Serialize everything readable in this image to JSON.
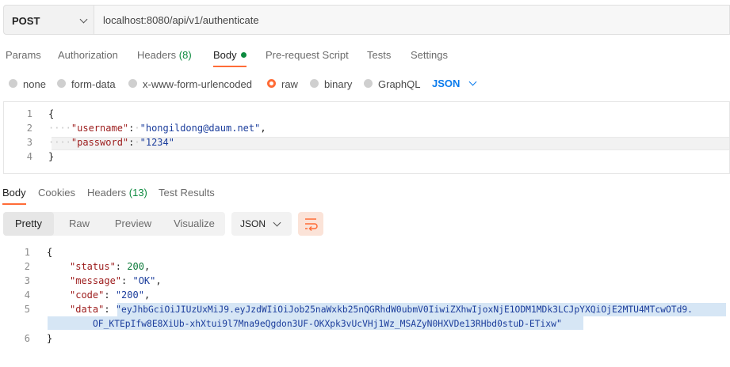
{
  "request": {
    "method": "POST",
    "url": "localhost:8080/api/v1/authenticate"
  },
  "request_tabs": [
    {
      "label": "Params"
    },
    {
      "label": "Authorization"
    },
    {
      "label": "Headers",
      "count": "(8)"
    },
    {
      "label": "Body"
    },
    {
      "label": "Pre-request Script"
    },
    {
      "label": "Tests"
    },
    {
      "label": "Settings"
    }
  ],
  "body_types": [
    {
      "label": "none"
    },
    {
      "label": "form-data"
    },
    {
      "label": "x-www-form-urlencoded"
    },
    {
      "label": "raw",
      "selected": true
    },
    {
      "label": "binary"
    },
    {
      "label": "GraphQL"
    }
  ],
  "body_format": "JSON",
  "request_body": {
    "lines": [
      "1",
      "2",
      "3",
      "4"
    ],
    "open": "{",
    "close": "}",
    "username_key": "\"username\"",
    "username_value": "\"hongildong@daum.net\"",
    "password_key": "\"password\"",
    "password_value": "\"1234\""
  },
  "response_tabs": [
    {
      "label": "Body"
    },
    {
      "label": "Cookies"
    },
    {
      "label": "Headers",
      "count": "(13)"
    },
    {
      "label": "Test Results"
    }
  ],
  "view_modes": [
    "Pretty",
    "Raw",
    "Preview",
    "Visualize"
  ],
  "response_format": "JSON",
  "response_body": {
    "lines": [
      "1",
      "2",
      "3",
      "4",
      "5",
      "6"
    ],
    "open": "{",
    "close": "}",
    "status_key": "\"status\"",
    "status_value": "200",
    "message_key": "\"message\"",
    "message_value": "\"OK\"",
    "code_key": "\"code\"",
    "code_value": "\"200\"",
    "data_key": "\"data\"",
    "data_value_part1": "eyJhbGciOiJIUzUxMiJ9.eyJzdWIiOiJob25naWxkb25nQGRhdW0ubmV0IiwiZXhwIjoxNjE1ODM1MDk3LCJpYXQiOjE2MTU4MTcwOTd9.",
    "data_value_part2": "OF_KTEpIfw8E8XiUb-xhXtui9l7Mna9eQgdon3UF-OKXpk3vUcVHj1Wz_MSAZyN0HXVDe13RHbd0stuD-ETixw"
  },
  "colors": {
    "accent": "#ff6c37",
    "link": "#097bed",
    "count": "#0d8a3f"
  }
}
